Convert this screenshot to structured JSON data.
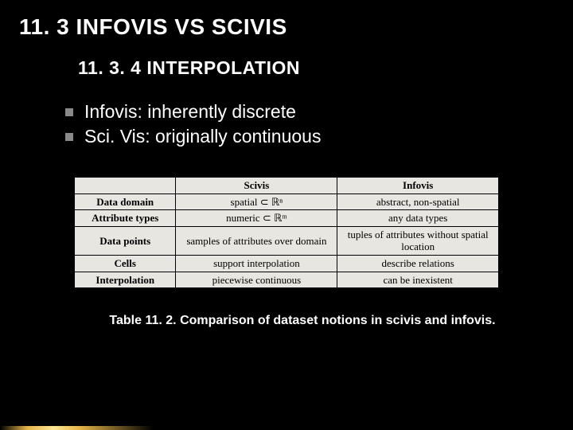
{
  "title": "11. 3 INFOVIS VS SCIVIS",
  "subtitle": "11. 3. 4 INTERPOLATION",
  "bullets": [
    "Infovis: inherently discrete",
    "Sci. Vis: originally continuous"
  ],
  "table": {
    "headers": [
      "",
      "Scivis",
      "Infovis"
    ],
    "rows": [
      {
        "label": "Data domain",
        "scivis": "spatial ⊂ ℝⁿ",
        "infovis": "abstract, non-spatial"
      },
      {
        "label": "Attribute types",
        "scivis": "numeric ⊂ ℝᵐ",
        "infovis": "any data types"
      },
      {
        "label": "Data points",
        "scivis": "samples of attributes over domain",
        "infovis": "tuples of attributes without spatial location"
      },
      {
        "label": "Cells",
        "scivis": "support interpolation",
        "infovis": "describe relations"
      },
      {
        "label": "Interpolation",
        "scivis": "piecewise continuous",
        "infovis": "can be inexistent"
      }
    ]
  },
  "caption": "Table 11. 2. Comparison of dataset notions in scivis and infovis."
}
